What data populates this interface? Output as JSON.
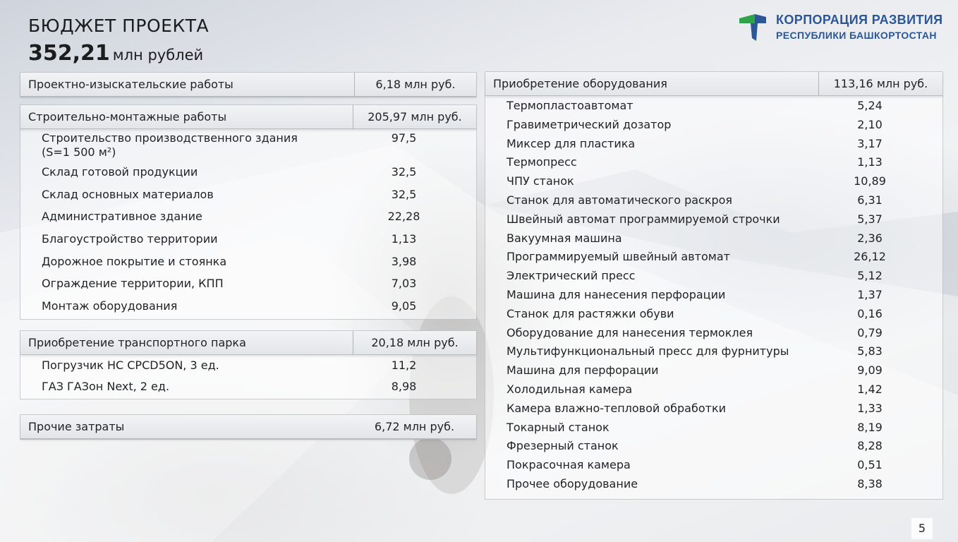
{
  "header": {
    "title": "БЮДЖЕТ ПРОЕКТА",
    "total_value": "352,21",
    "total_unit": "млн рублей"
  },
  "logo": {
    "line1": "КОРПОРАЦИЯ РАЗВИТИЯ",
    "line2": "РЕСПУБЛИКИ БАШКОРТОСТАН",
    "colors": {
      "green": "#2fa34a",
      "blue": "#2b5797"
    }
  },
  "left": {
    "design": {
      "label": "Проектно-изыскательские работы",
      "value": "6,18 млн руб."
    },
    "construction": {
      "label": "Строительно-монтажные работы",
      "value": "205,97 млн руб.",
      "items": [
        {
          "label": "Строительство производственного здания",
          "label2": "(S=1 500 м²)",
          "value": "97,5"
        },
        {
          "label": "Склад готовой продукции",
          "value": "32,5"
        },
        {
          "label": "Склад основных материалов",
          "value": "32,5"
        },
        {
          "label": "Административное здание",
          "value": "22,28"
        },
        {
          "label": "Благоустройство территории",
          "value": "1,13"
        },
        {
          "label": "Дорожное покрытие и стоянка",
          "value": "3,98"
        },
        {
          "label": "Ограждение территории, КПП",
          "value": "7,03"
        },
        {
          "label": "Монтаж оборудования",
          "value": "9,05"
        }
      ]
    },
    "transport": {
      "label": "Приобретение транспортного парка",
      "value": "20,18 млн руб.",
      "items": [
        {
          "label": "Погрузчик HC CPCD5ON, 3 ед.",
          "value": "11,2"
        },
        {
          "label": "ГАЗ ГАЗон Next, 2 ед.",
          "value": "8,98"
        }
      ]
    },
    "other": {
      "label": "Прочие затраты",
      "value": "6,72 млн руб."
    }
  },
  "right": {
    "equipment": {
      "label": "Приобретение оборудования",
      "value": "113,16 млн руб.",
      "items": [
        {
          "label": "Термопластоавтомат",
          "value": "5,24"
        },
        {
          "label": "Гравиметрический дозатор",
          "value": "2,10"
        },
        {
          "label": "Миксер для пластика",
          "value": "3,17"
        },
        {
          "label": "Термопресс",
          "value": "1,13"
        },
        {
          "label": "ЧПУ станок",
          "value": "10,89"
        },
        {
          "label": "Станок для автоматического раскроя",
          "value": "6,31"
        },
        {
          "label": "Швейный автомат программируемой строчки",
          "value": "5,37"
        },
        {
          "label": "Вакуумная машина",
          "value": "2,36"
        },
        {
          "label": "Программируемый швейный автомат",
          "value": "26,12"
        },
        {
          "label": "Электрический пресс",
          "value": "5,12"
        },
        {
          "label": "Машина для нанесения перфорации",
          "value": "1,37"
        },
        {
          "label": "Станок для растяжки обуви",
          "value": "0,16"
        },
        {
          "label": "Оборудование для нанесения термоклея",
          "value": "0,79"
        },
        {
          "label": "Мультифункциональный пресс для фурнитуры",
          "value": "5,83"
        },
        {
          "label": "Машина для перфорации",
          "value": "9,09"
        },
        {
          "label": "Холодильная камера",
          "value": "1,42"
        },
        {
          "label": "Камера влажно-тепловой обработки",
          "value": "1,33"
        },
        {
          "label": "Токарный станок",
          "value": "8,19"
        },
        {
          "label": "Фрезерный станок",
          "value": "8,28"
        },
        {
          "label": "Покрасочная камера",
          "value": "0,51"
        },
        {
          "label": "Прочее оборудование",
          "value": "8,38"
        }
      ]
    }
  },
  "page_number": "5"
}
